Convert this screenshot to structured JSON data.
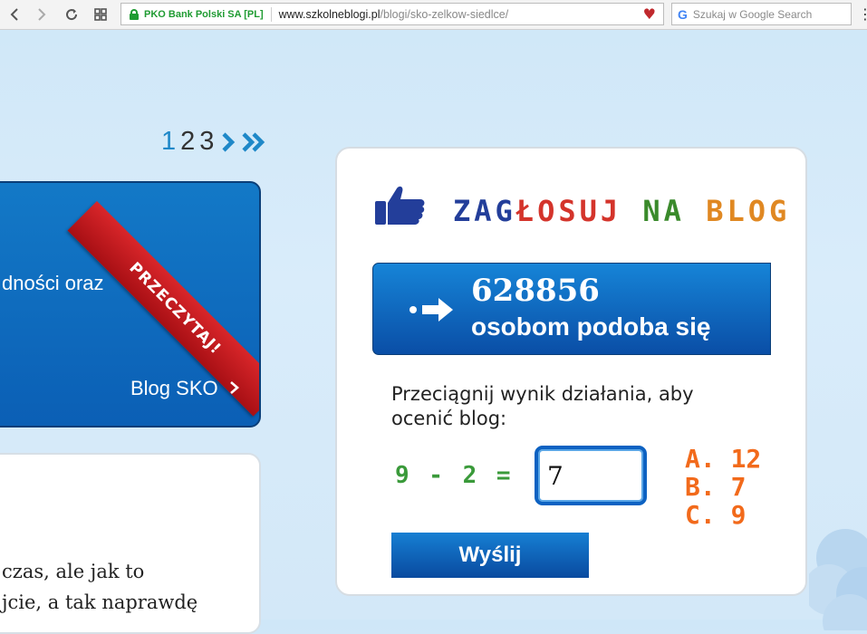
{
  "browser": {
    "back_icon": "chevron-left-icon",
    "forward_icon": "chevron-right-icon",
    "reload_icon": "reload-icon",
    "grid_icon": "grid-icon",
    "certificate_owner": "PKO Bank Polski SA [PL]",
    "url_host": "www.szkolneblogi.pl",
    "url_path": "/blogi/sko-zelkow-siedlce/",
    "search_placeholder": "Szukaj w Google Search",
    "bookmark_icon": "heart-icon",
    "accent_lock_color": "#1f9b32"
  },
  "pagination": {
    "pages": [
      "1",
      "2",
      "3"
    ],
    "active_page": "1",
    "next_icon": "›",
    "last_icon": "»"
  },
  "promo_card": {
    "ribbon": "PRZECZYTAJ!",
    "text": "dności oraz",
    "link_label": "Blog SKO",
    "link_icon": "›"
  },
  "card2": {
    "line1": "czas, ale jak to",
    "line2": "jcie, a tak naprawdę"
  },
  "vote": {
    "title_parts": [
      "ZAG",
      "ŁOSUJ",
      " NA ",
      "BLOG"
    ],
    "likes_count": "628856",
    "likes_label": "osobom podoba się",
    "instruction": "Przeciągnij wynik działania, aby ocenić blog:",
    "equation": "9 - 2 =",
    "answer_value": "7",
    "options": [
      "A. 12",
      "B. 7",
      "C. 9"
    ],
    "submit_label": "Wyślij"
  }
}
